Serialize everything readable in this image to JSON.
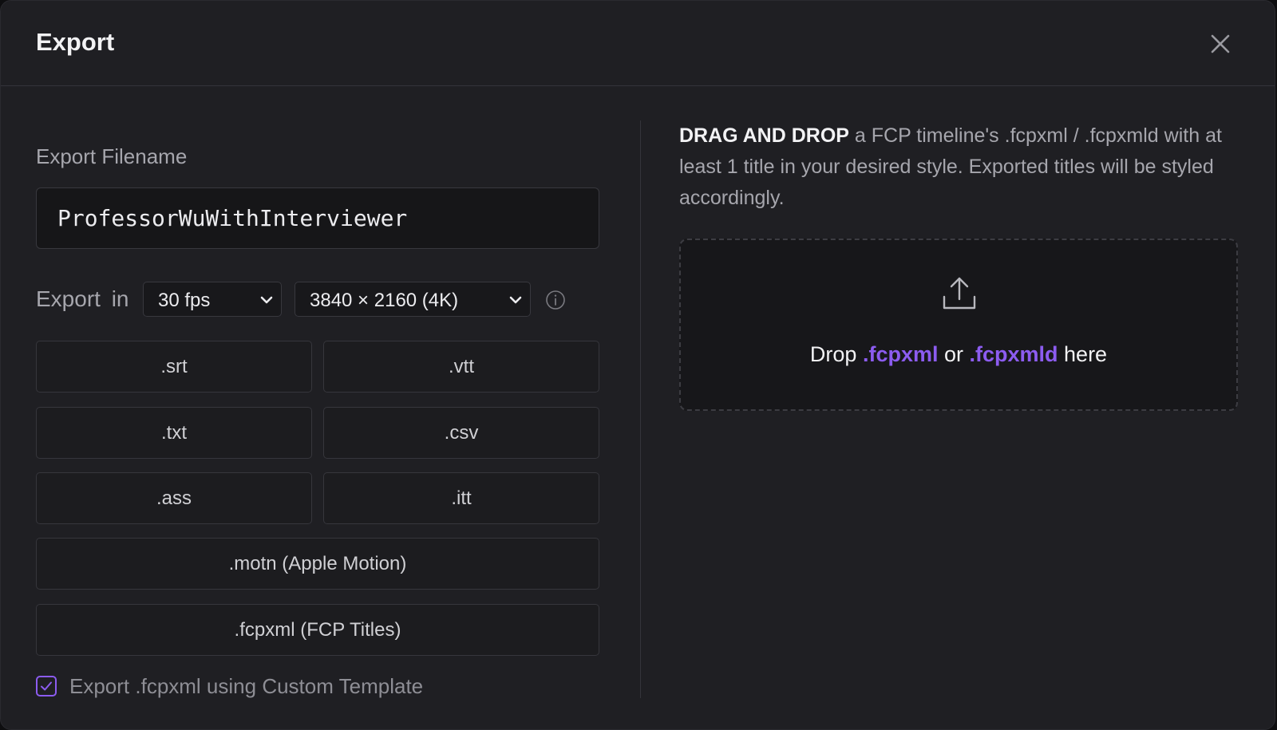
{
  "dialog": {
    "title": "Export",
    "close_icon": "close-icon"
  },
  "left": {
    "filename_label": "Export Filename",
    "filename_value": "ProfessorWuWithInterviewer",
    "export_in_label": "Export  in",
    "fps_selected": "30 fps",
    "resolution_selected": "3840 × 2160 (4K)",
    "info_icon": "info-icon",
    "formats": [
      ".srt",
      ".vtt",
      ".txt",
      ".csv",
      ".ass",
      ".itt"
    ],
    "motion_button": ".motn (Apple Motion)",
    "fcp_button": ".fcpxml (FCP Titles)",
    "custom_template_label": "Export .fcpxml using Custom Template",
    "custom_template_checked": true
  },
  "right": {
    "desc_strong": "DRAG AND DROP",
    "desc_rest": " a FCP timeline's .fcpxml / .fcpxmld with at least 1 title in your desired style. Exported titles will be styled accordingly.",
    "drop_prefix": "Drop ",
    "drop_ext1": ".fcpxml",
    "drop_or": " or ",
    "drop_ext2": ".fcpxmld",
    "drop_suffix": " here",
    "upload_icon": "upload-icon"
  },
  "colors": {
    "accent": "#8c5cf0",
    "background": "#1f1f23"
  }
}
